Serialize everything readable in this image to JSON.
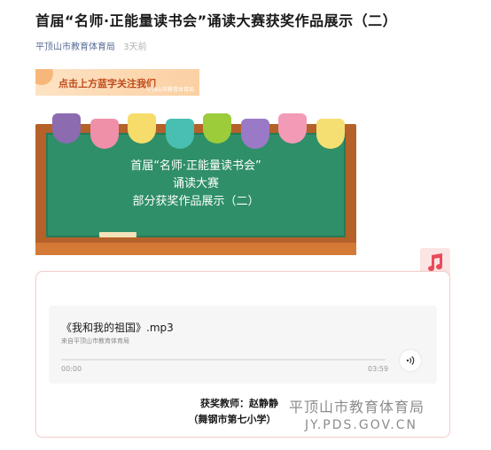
{
  "article": {
    "title": "首届“名师·正能量读书会”诵读大赛获奖作品展示（二）",
    "author": "平顶山市教育体育局",
    "time": "3天前"
  },
  "banner": {
    "text": "点击上方蓝字关注我们",
    "sub": "平顶山市教育体育局"
  },
  "board": {
    "line1": "首届“名师·正能量读书会”",
    "line2": "诵读大赛",
    "line3": "部分获奖作品展示（二）",
    "flag_colors": [
      "#8c6bb1",
      "#ef8fa8",
      "#f6dc6a",
      "#48bfb0",
      "#9ccc3a",
      "#9a79c6",
      "#f39bb6",
      "#f6df72"
    ]
  },
  "audio": {
    "name": "《我和我的祖国》.mp3",
    "source": "来自平顶山市教育体育局",
    "current_time": "00:00",
    "duration": "03:59",
    "progress": 0
  },
  "award": {
    "line1": "获奖教师：赵静静",
    "line2": "（舞钢市第七小学）"
  },
  "watermark": {
    "line1": "平顶山市教育体育局",
    "line2": "JY.PDS.GOV.CN"
  },
  "icons": [
    "music-note-icon",
    "speaker-icon"
  ]
}
